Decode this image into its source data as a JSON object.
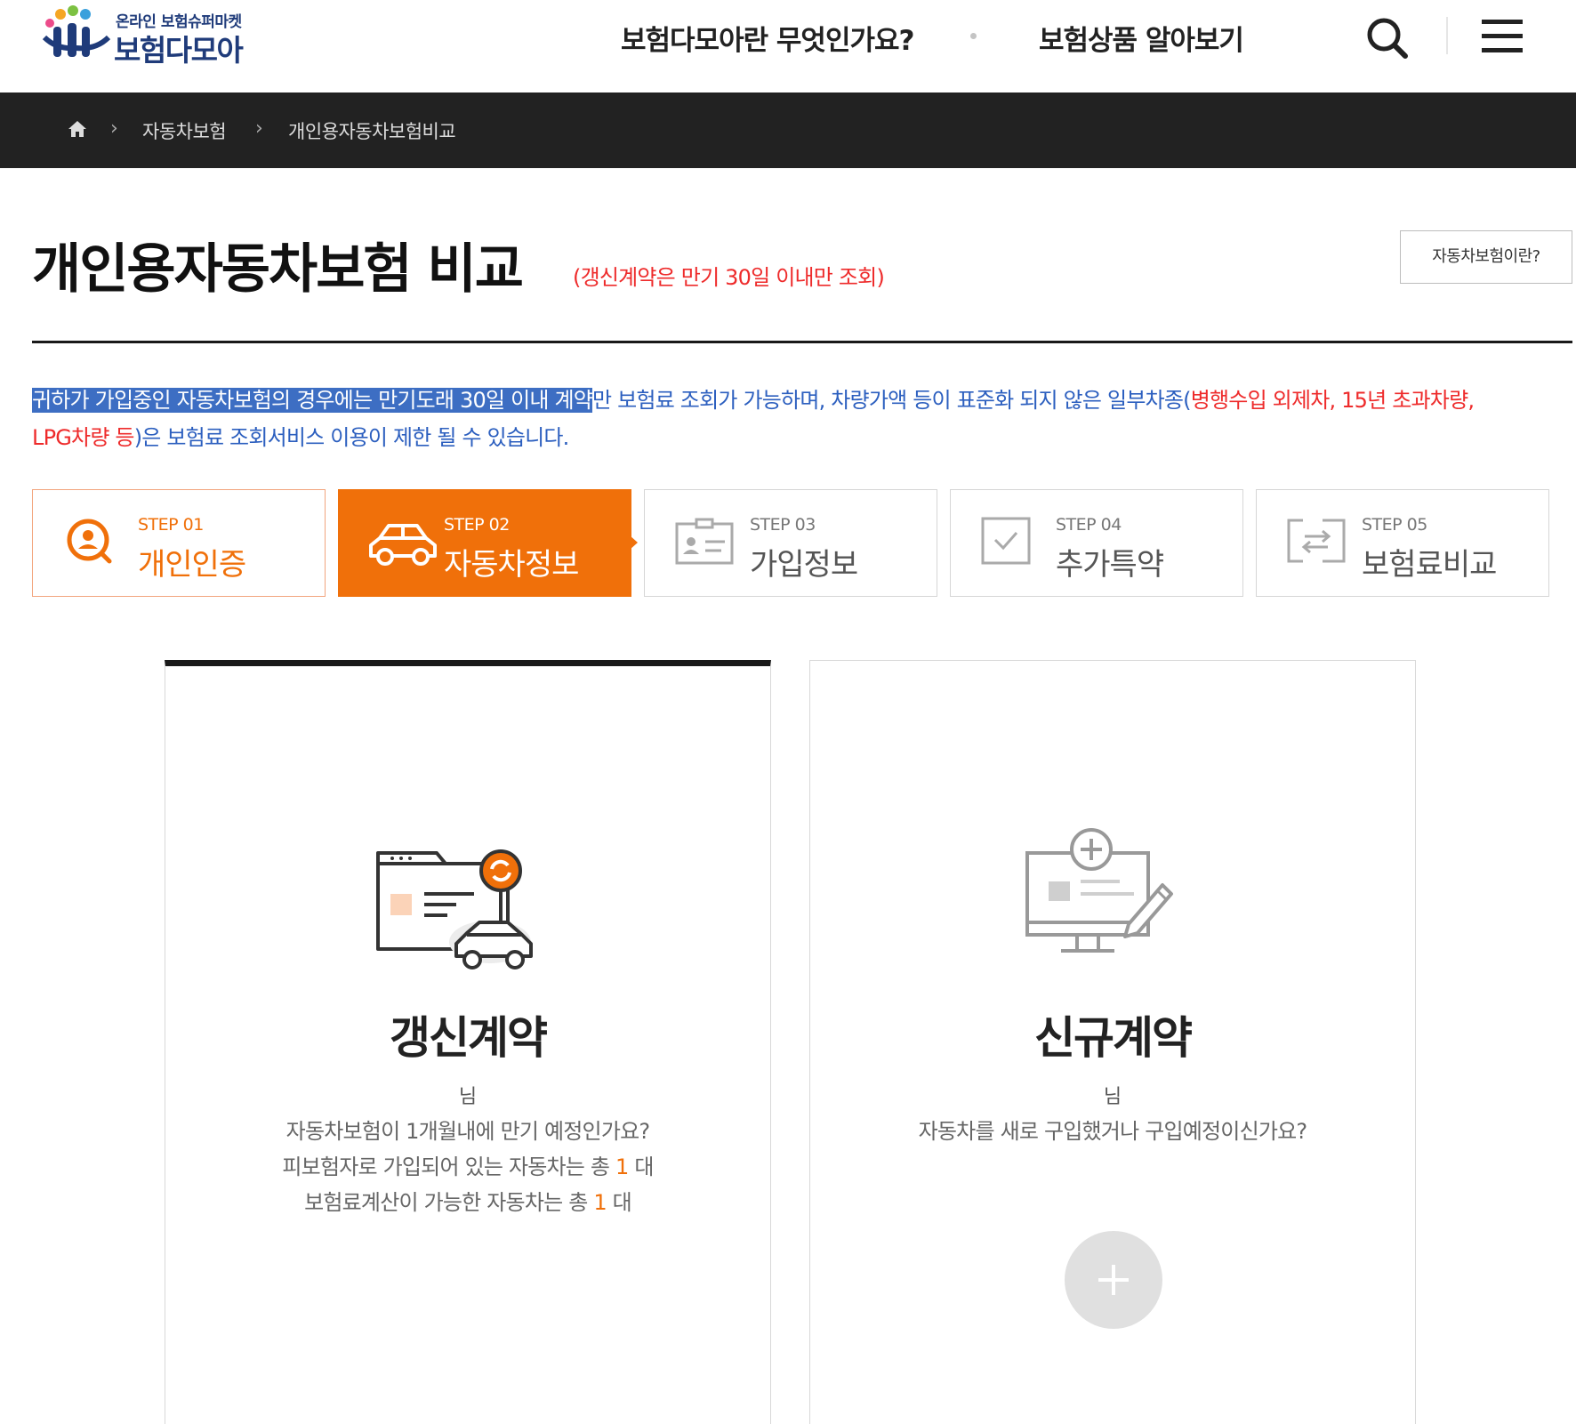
{
  "header": {
    "logo_sub": "온라인 보험슈퍼마켓",
    "logo_main": "보험다모아",
    "nav": [
      "보험다모아란 무엇인가요?",
      "보험상품 알아보기"
    ],
    "icons": [
      "search-icon",
      "hamburger-menu-icon"
    ]
  },
  "breadcrumb": {
    "home_icon": "home-icon",
    "items": [
      "자동차보험",
      "개인용자동차보험비교"
    ]
  },
  "page": {
    "title": "개인용자동차보험 비교",
    "title_note": "(갱신계약은 만기 30일 이내만 조회)",
    "about_button": "자동차보험이란?"
  },
  "notice": {
    "selected": "귀하가 가입중인 자동차보험의 경우에는 만기도래 30일 이내 계약",
    "part1": "만 보험료 조회가 가능하며, 차량가액 등이 표준화 되지 않은 일부차종(",
    "red1": "병행수입 외제차, 15년 초과차량,",
    "red2": "LPG차량 등",
    "part2": ")은 보험료 조회서비스 이용이 제한 될 수 있습니다."
  },
  "steps": [
    {
      "no": "STEP 01",
      "name": "개인인증",
      "state": "done",
      "icon": "user-search-icon"
    },
    {
      "no": "STEP 02",
      "name": "자동차정보",
      "state": "active",
      "icon": "car-icon"
    },
    {
      "no": "STEP 03",
      "name": "가입정보",
      "state": "pending",
      "icon": "id-card-icon"
    },
    {
      "no": "STEP 04",
      "name": "추가특약",
      "state": "pending",
      "icon": "checkbox-icon"
    },
    {
      "no": "STEP 05",
      "name": "보험료비교",
      "state": "pending",
      "icon": "compare-icon"
    }
  ],
  "colors": {
    "accent": "#f0700a",
    "notice_blue": "#2c5fbf",
    "warning_red": "#ee2b2b",
    "breadcrumb_bg": "#222222"
  },
  "cards": {
    "renewal": {
      "title": "갱신계약",
      "user_suffix": "님",
      "line1": "자동차보험이 1개월내에 만기 예정인가요?",
      "line2_pre": "피보험자로 가입되어 있는 자동차는 총 ",
      "line2_num": "1",
      "line2_post": " 대",
      "line3_pre": "보험료계산이 가능한 자동차는 총 ",
      "line3_num": "1",
      "line3_post": " 대",
      "icon": "renewal-car-document-icon"
    },
    "new": {
      "title": "신규계약",
      "user_suffix": "님",
      "line1": "자동차를 새로 구입했거나 구입예정이신가요?",
      "icon": "new-contract-monitor-icon",
      "add_icon": "plus-icon"
    }
  }
}
